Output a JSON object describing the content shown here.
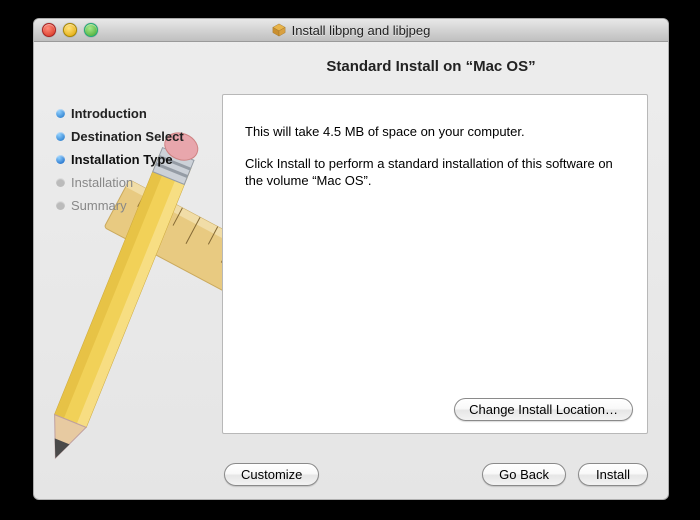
{
  "window": {
    "title": "Install libpng and libjpeg"
  },
  "heading": "Standard Install on “Mac OS”",
  "sidebar": {
    "steps": [
      {
        "label": "Introduction",
        "state": "done"
      },
      {
        "label": "Destination Select",
        "state": "done"
      },
      {
        "label": "Installation Type",
        "state": "active"
      },
      {
        "label": "Installation",
        "state": "pending"
      },
      {
        "label": "Summary",
        "state": "pending"
      }
    ]
  },
  "content": {
    "line1": "This will take 4.5 MB of space on your computer.",
    "line2": "Click Install to perform a standard installation of this software on the volume “Mac OS”."
  },
  "buttons": {
    "change_location": "Change Install Location…",
    "customize": "Customize",
    "go_back": "Go Back",
    "install": "Install"
  }
}
